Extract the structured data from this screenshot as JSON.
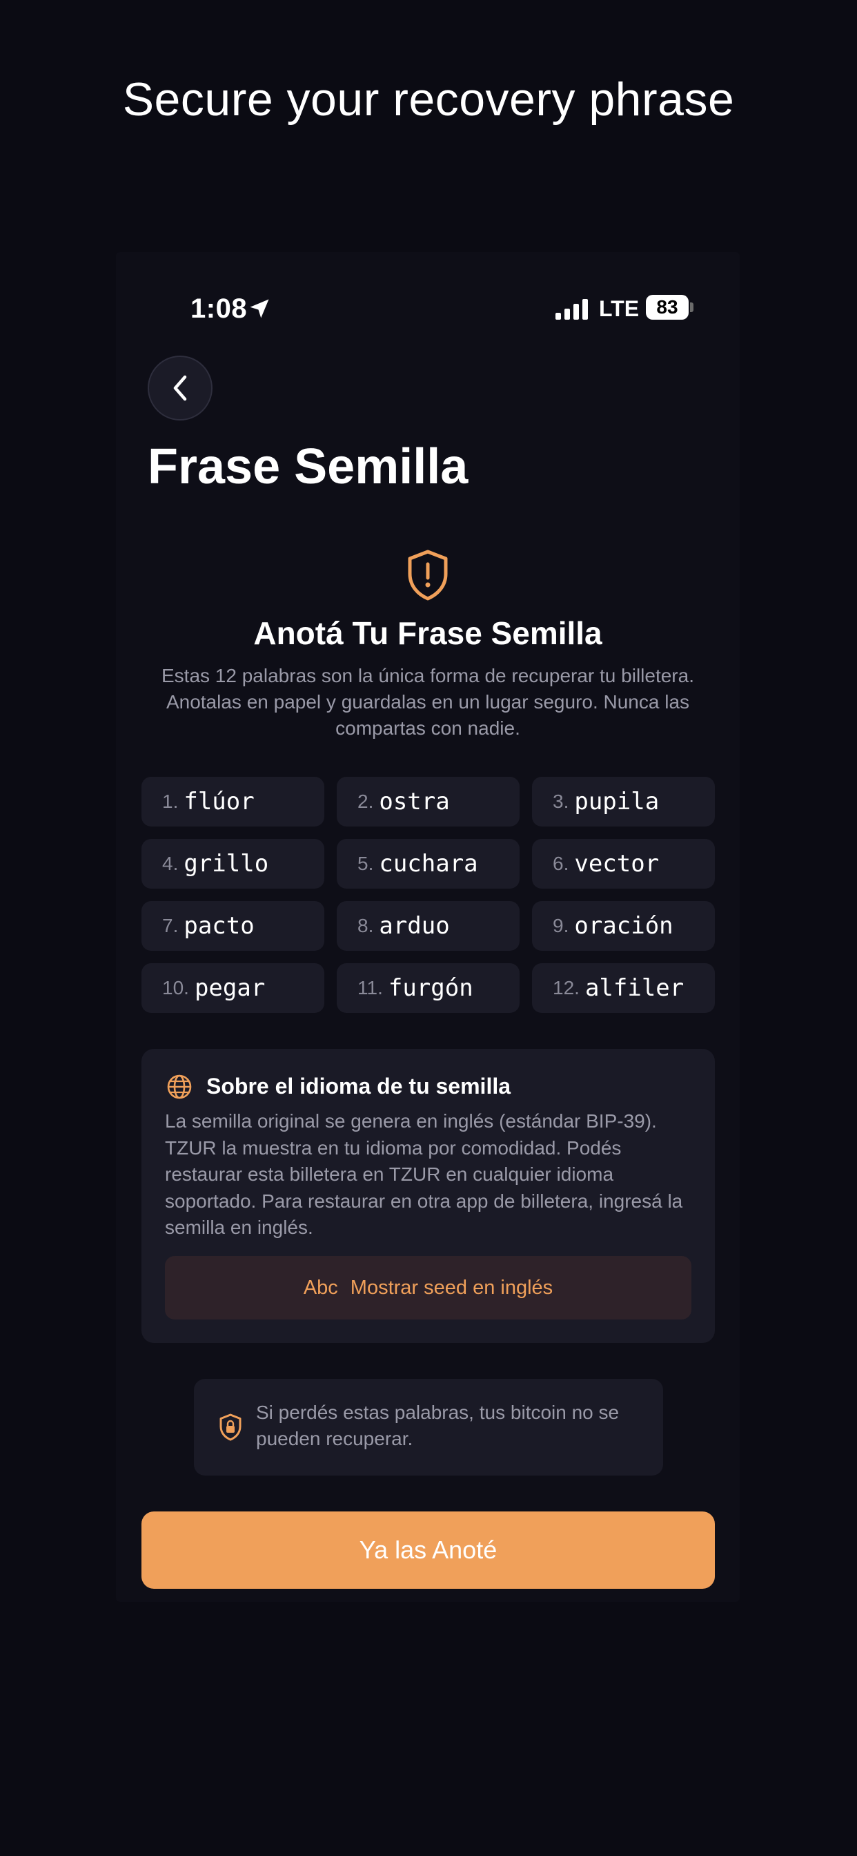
{
  "promo": {
    "title": "Secure your recovery phrase"
  },
  "status_bar": {
    "time": "1:08",
    "network": "LTE",
    "battery": "83"
  },
  "screen": {
    "title": "Frase Semilla"
  },
  "header": {
    "heading": "Anotá Tu Frase Semilla",
    "description": "Estas 12 palabras son la única forma de recuperar tu billetera. Anotalas en papel y guardalas en un lugar seguro. Nunca las compartas con nadie."
  },
  "words": [
    {
      "num": "1.",
      "word": "flúor"
    },
    {
      "num": "2.",
      "word": "ostra"
    },
    {
      "num": "3.",
      "word": "pupila"
    },
    {
      "num": "4.",
      "word": "grillo"
    },
    {
      "num": "5.",
      "word": "cuchara"
    },
    {
      "num": "6.",
      "word": "vector"
    },
    {
      "num": "7.",
      "word": "pacto"
    },
    {
      "num": "8.",
      "word": "arduo"
    },
    {
      "num": "9.",
      "word": "oración"
    },
    {
      "num": "10.",
      "word": "pegar"
    },
    {
      "num": "11.",
      "word": "furgón"
    },
    {
      "num": "12.",
      "word": "alfiler"
    }
  ],
  "language_info": {
    "title": "Sobre el idioma de tu semilla",
    "body": "La semilla original se genera en inglés (estándar BIP-39). TZUR la muestra en tu idioma por comodidad. Podés restaurar esta billetera en TZUR en cualquier idioma soportado. Para restaurar en otra app de billetera, ingresá la semilla en inglés.",
    "button_icon": "Abc",
    "button_label": "Mostrar seed en inglés"
  },
  "warning": {
    "text": "Si perdés estas palabras, tus bitcoin no se pueden recuperar."
  },
  "primary_button": {
    "label": "Ya las Anoté"
  },
  "colors": {
    "accent": "#f0a05a",
    "background": "#0b0b13",
    "card": "#1b1b27"
  }
}
